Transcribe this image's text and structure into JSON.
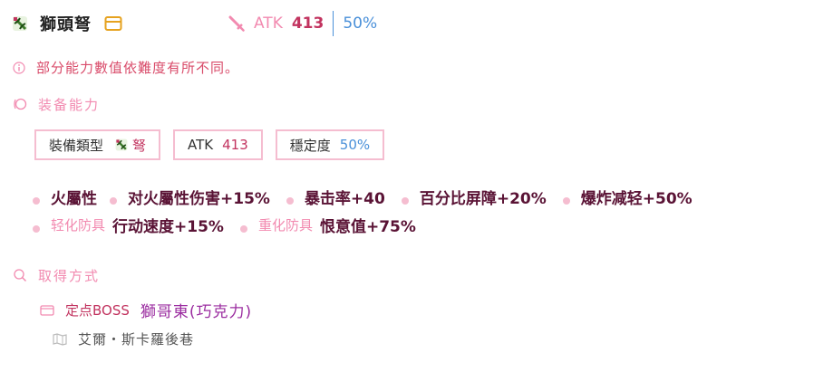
{
  "header": {
    "item_name": "獅頭弩",
    "atk_label": "ATK",
    "atk_value": "413",
    "stability_value": "50%"
  },
  "note": "部分能力數值依難度有所不同。",
  "equipment_section": {
    "title": "装备能力",
    "boxes": {
      "type_label": "裝備類型",
      "type_value": "弩",
      "atk_label": "ATK",
      "atk_value": "413",
      "stability_label": "穩定度",
      "stability_value": "50%"
    }
  },
  "effects_row1": [
    {
      "label": "火屬性",
      "text": "对火屬性伤害+15%"
    },
    {
      "text": "暴击率+40"
    },
    {
      "text": "百分比屏障+20%"
    },
    {
      "text": "爆炸减轻+50%"
    }
  ],
  "effects_row2": [
    {
      "label": "轻化防具",
      "text": "行动速度+15%"
    },
    {
      "label": "重化防具",
      "text": "恨意值+75%"
    }
  ],
  "acquisition": {
    "title": "取得方式",
    "source_type": "定点BOSS",
    "source_name": "獅哥東(巧克力)",
    "location": "艾爾・斯卡羅後巷"
  },
  "colors": {
    "accent_pink": "#f28ab0",
    "accent_dark_pink": "#c2335f",
    "accent_blue": "#4a90d9",
    "effect_text": "#5a1335",
    "note_red": "#d94b6a"
  },
  "icons": [
    "crossbow-icon",
    "card-icon",
    "sword-icon",
    "info-icon",
    "equipment-icon",
    "search-icon",
    "mail-icon",
    "map-icon"
  ]
}
